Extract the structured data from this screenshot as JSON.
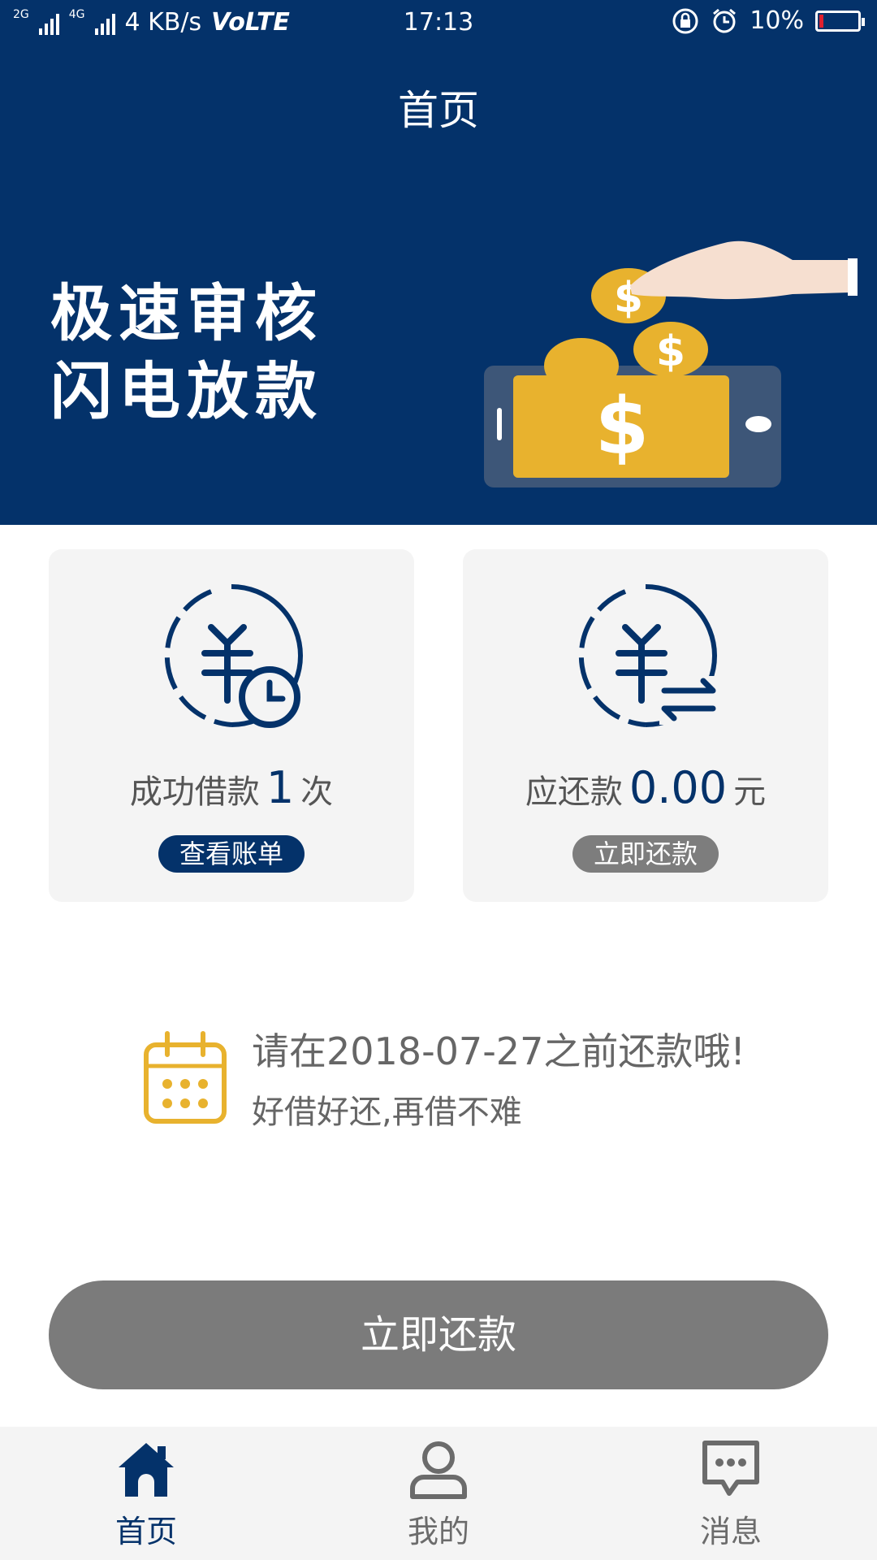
{
  "status_bar": {
    "network_left": "2G",
    "network_right": "4G",
    "speed": "4 KB/s",
    "volte": "VoLTE",
    "time": "17:13",
    "battery": "10%",
    "battery_level": 0.1
  },
  "header": {
    "title": "首页"
  },
  "banner": {
    "line1": "极速审核",
    "line2": "闪电放款"
  },
  "cards": {
    "left": {
      "icon": "yen-clock-icon",
      "prefix": "成功借款",
      "value": "1",
      "suffix": "次",
      "button": "查看账单"
    },
    "right": {
      "icon": "yen-exchange-icon",
      "prefix": "应还款",
      "value": "0.00",
      "suffix": "元",
      "button": "立即还款"
    }
  },
  "notice": {
    "icon": "calendar-icon",
    "line1": "请在2018-07-27之前还款哦!",
    "line2": "好借好还,再借不难"
  },
  "main_button": {
    "label": "立即还款"
  },
  "tabbar": {
    "items": [
      {
        "label": "首页",
        "icon": "home-icon",
        "active": true
      },
      {
        "label": "我的",
        "icon": "user-icon",
        "active": false
      },
      {
        "label": "消息",
        "icon": "message-icon",
        "active": false
      }
    ]
  },
  "colors": {
    "primary": "#04326a",
    "gold": "#e8b22e",
    "gray_button": "#7b7b7b",
    "card_bg": "#f4f4f4"
  }
}
